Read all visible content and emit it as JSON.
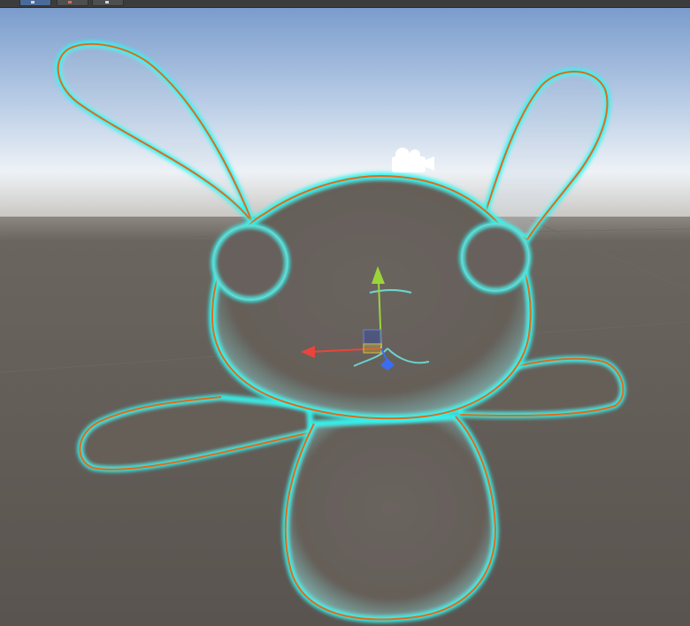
{
  "window": {
    "panel": "Scene View"
  },
  "toolbar": {
    "buttons": [
      {
        "icon": "hand-tool-icon",
        "active": true
      },
      {
        "icon": "move-tool-icon",
        "active": false
      },
      {
        "icon": "rotate-tool-icon",
        "active": false
      }
    ]
  },
  "scene": {
    "selected_object": "bunny",
    "gizmo": {
      "x_axis_color": "#e8453c",
      "y_axis_color": "#9bd43a",
      "z_axis_color": "#3b6df0"
    },
    "colors": {
      "outline_outer": "#e06a1c",
      "outline_inner": "#31f6f0",
      "sky_top": "#7a9ccc",
      "ground": "#5f5954",
      "body": "#65605a"
    },
    "camera_icon": "camera-gizmo-icon"
  }
}
